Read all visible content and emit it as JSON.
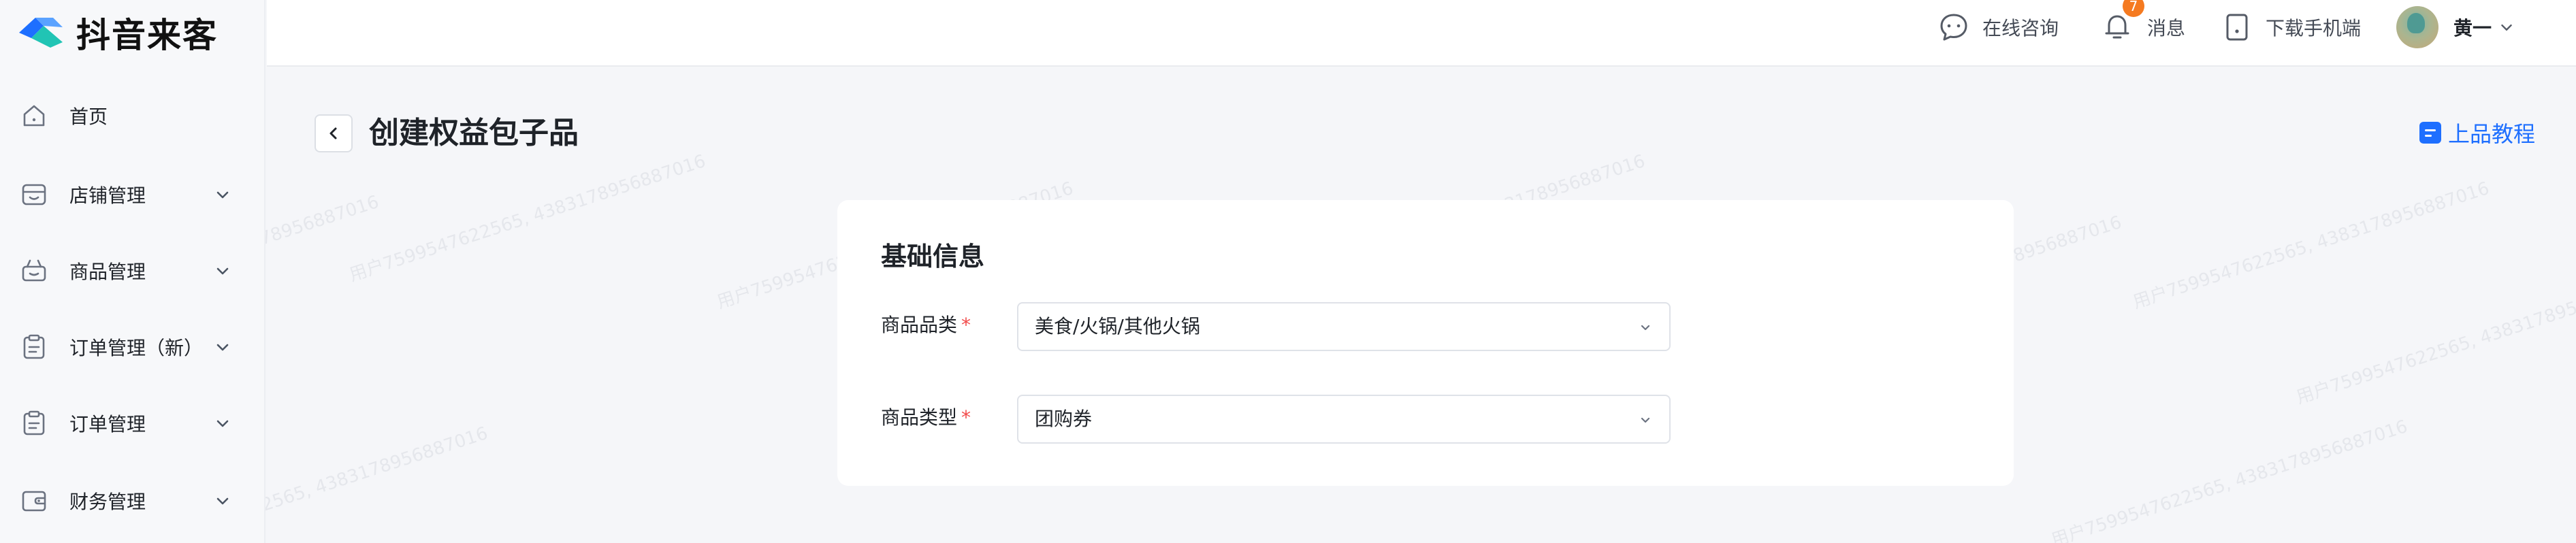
{
  "app": {
    "name": "抖音来客"
  },
  "sidebar": {
    "items": [
      {
        "label": "首页",
        "icon": "home-icon",
        "expandable": false
      },
      {
        "label": "店铺管理",
        "icon": "store-icon",
        "expandable": true
      },
      {
        "label": "商品管理",
        "icon": "shopping-basket-icon",
        "expandable": true
      },
      {
        "label": "订单管理（新）",
        "icon": "clipboard-icon",
        "expandable": true
      },
      {
        "label": "订单管理",
        "icon": "clipboard-icon",
        "expandable": true
      },
      {
        "label": "财务管理",
        "icon": "wallet-icon",
        "expandable": true
      }
    ]
  },
  "header": {
    "consult": {
      "label": "在线咨询",
      "icon": "chat-icon"
    },
    "messages": {
      "label": "消息",
      "icon": "bell-icon",
      "badge": "7"
    },
    "download": {
      "label": "下载手机端",
      "icon": "mobile-icon"
    },
    "user": {
      "name": "黄一",
      "icon": "chevron-down-icon"
    }
  },
  "page": {
    "title": "创建权益包子品",
    "tutorial_label": "上品教程"
  },
  "form": {
    "section_title": "基础信息",
    "category": {
      "label": "商品品类",
      "required_mark": "*",
      "value": "美食/火锅/其他火锅"
    },
    "type": {
      "label": "商品类型",
      "required_mark": "*",
      "value": "团购券"
    }
  },
  "watermark": {
    "text": "用户7599547622565, 4383178956887016"
  },
  "colors": {
    "accent": "#1e6fff",
    "badge": "#f57a20",
    "required": "#f24b4b",
    "logo_primary": "#1e6fff",
    "logo_secondary": "#21c4b4"
  }
}
